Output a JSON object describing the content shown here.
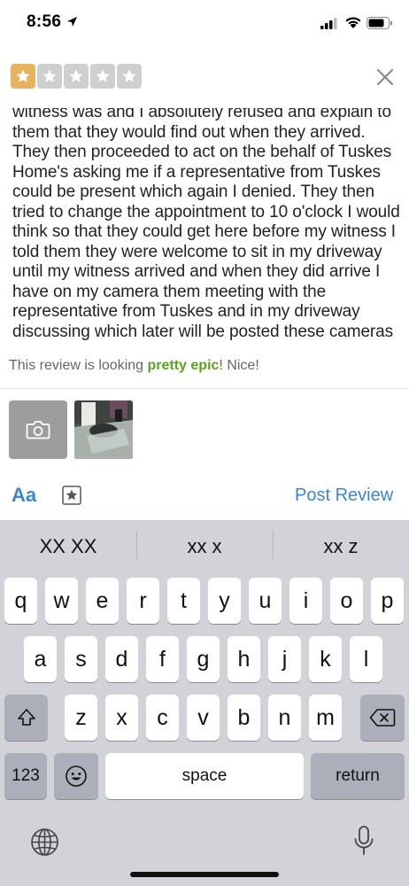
{
  "status_bar": {
    "time": "8:56"
  },
  "rating": {
    "filled_stars": 1,
    "total_stars": 5,
    "filled_color": "#e8b35f",
    "empty_color": "#cfcfcf"
  },
  "review": {
    "text": "witness was and I absolutely refused and explain to them that they would find out when they arrived. They then proceeded to act on the behalf of Tuskes Home's asking me if a representative from Tuskes could be present which again I denied. They then tried to change the appointment to 10 o'clock I would think so that they could get here before my witness I told them they were welcome to sit in my driveway until my witness arrived and when they did arrive I have on my camera them meeting with the representative from Tuskes and in my driveway discussing which later will be posted these cameras"
  },
  "hint": {
    "prefix": "This review is looking ",
    "highlight": "pretty epic",
    "suffix": "! Nice!"
  },
  "toolbar": {
    "format_label": "Aa",
    "post_label": "Post Review"
  },
  "keyboard": {
    "suggestions": [
      "XX XX",
      "xx x",
      "xx z"
    ],
    "row1": [
      "q",
      "w",
      "e",
      "r",
      "t",
      "y",
      "u",
      "i",
      "o",
      "p"
    ],
    "row2": [
      "a",
      "s",
      "d",
      "f",
      "g",
      "h",
      "j",
      "k",
      "l"
    ],
    "row3": [
      "z",
      "x",
      "c",
      "v",
      "b",
      "n",
      "m"
    ],
    "numbers_label": "123",
    "space_label": "space",
    "return_label": "return"
  },
  "colors": {
    "accent": "#3b87c9",
    "epic_green": "#5aa321",
    "keyboard_bg": "#d1d3d9"
  }
}
